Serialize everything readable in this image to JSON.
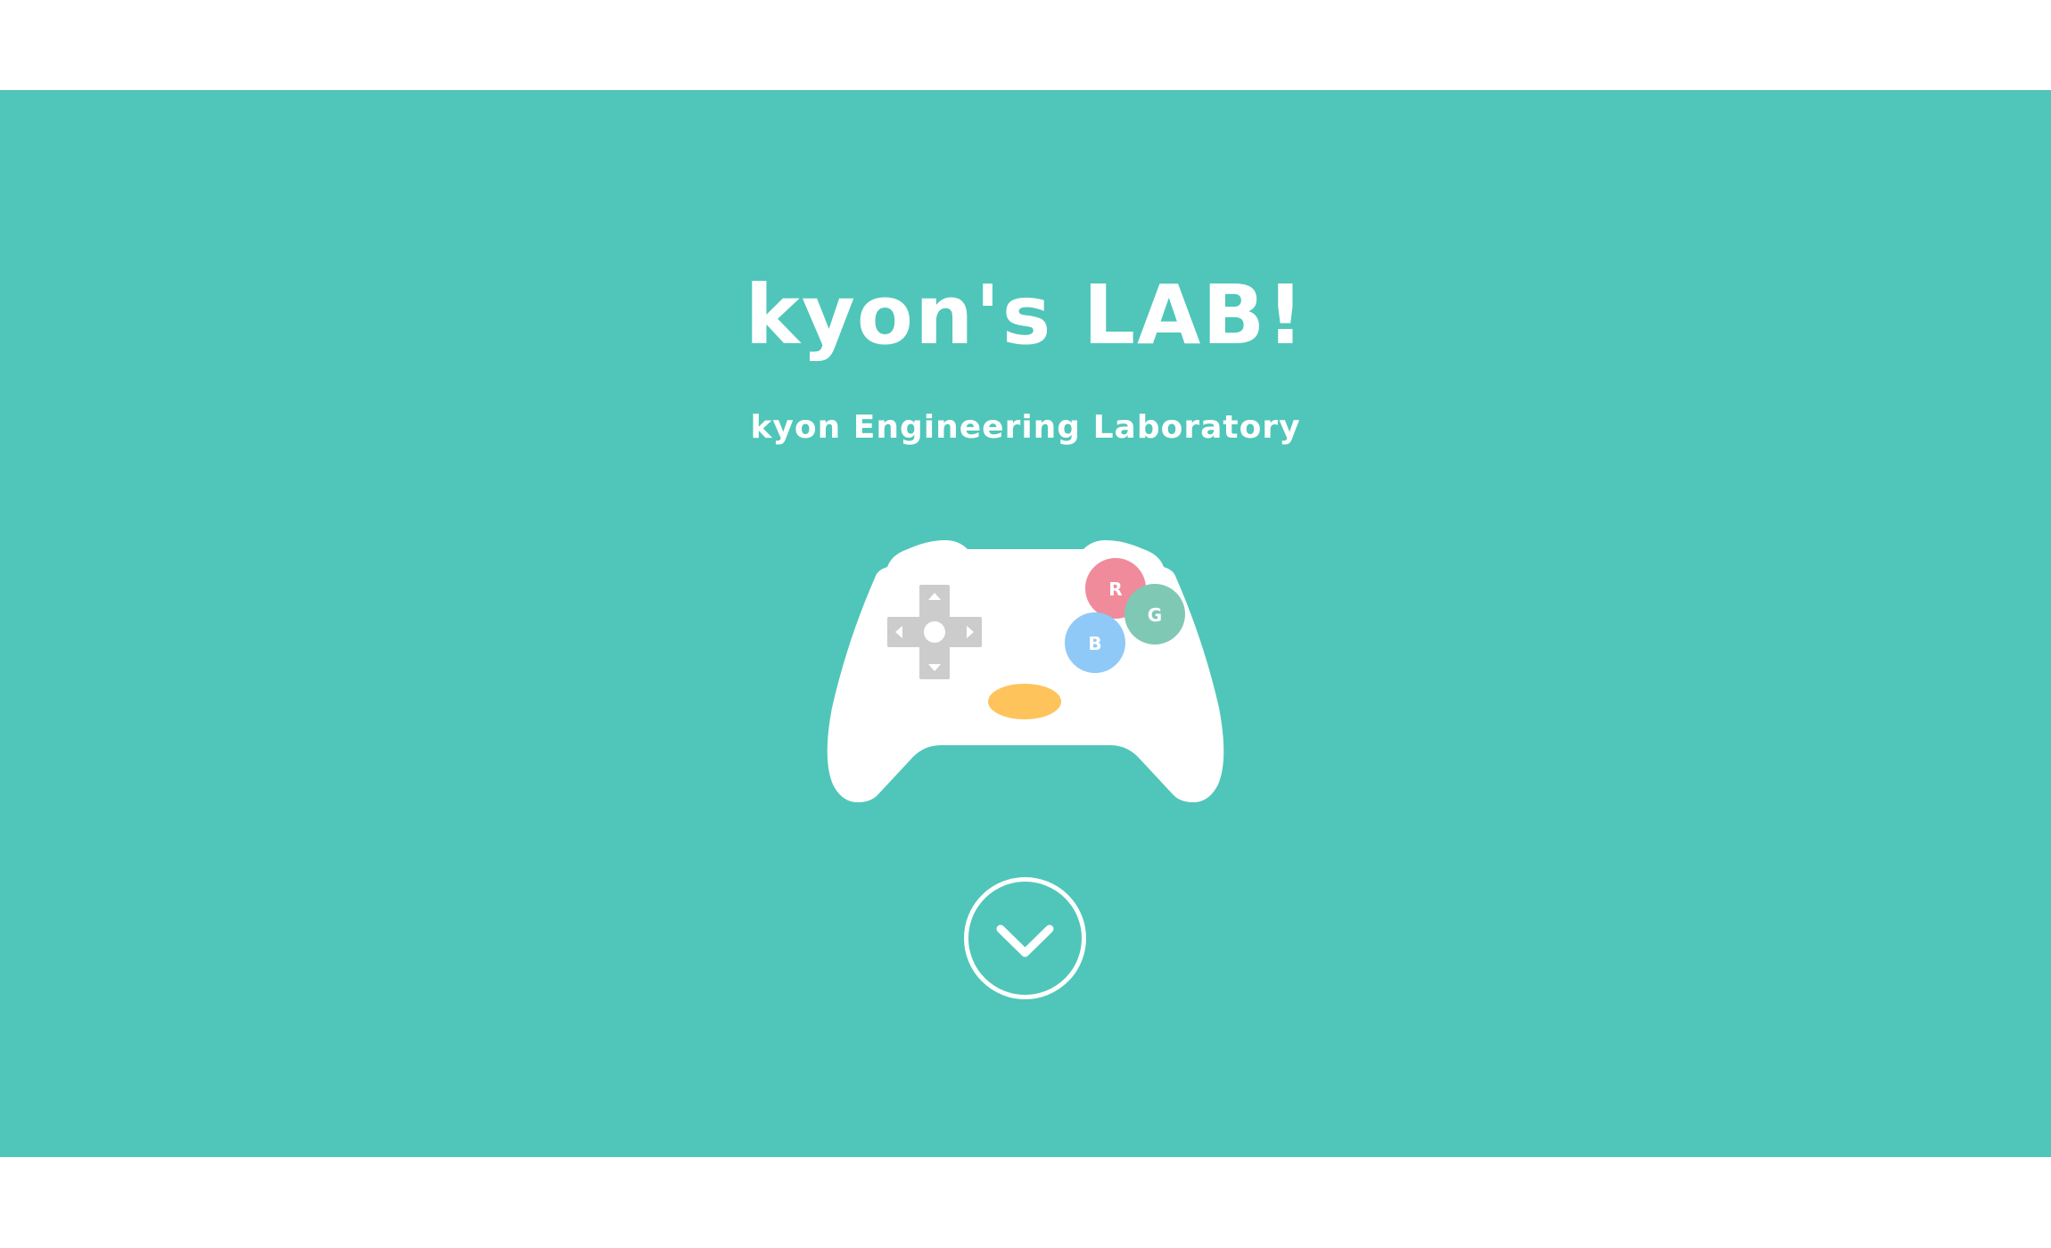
{
  "hero": {
    "title": "kyon's LAB!",
    "subtitle": "kyon Engineering Laboratory",
    "background_color": "#4fc6b9"
  },
  "controller": {
    "icon": "gamepad-icon",
    "buttons": {
      "red_label": "R",
      "green_label": "G",
      "blue_label": "B"
    },
    "colors": {
      "body": "#ffffff",
      "dpad": "#cccccc",
      "red": "#ef8b9a",
      "green": "#7fc8b4",
      "blue": "#8fc9f7",
      "center": "#fec35b"
    }
  },
  "scroll_down": {
    "icon": "chevron-down-circle-icon"
  }
}
